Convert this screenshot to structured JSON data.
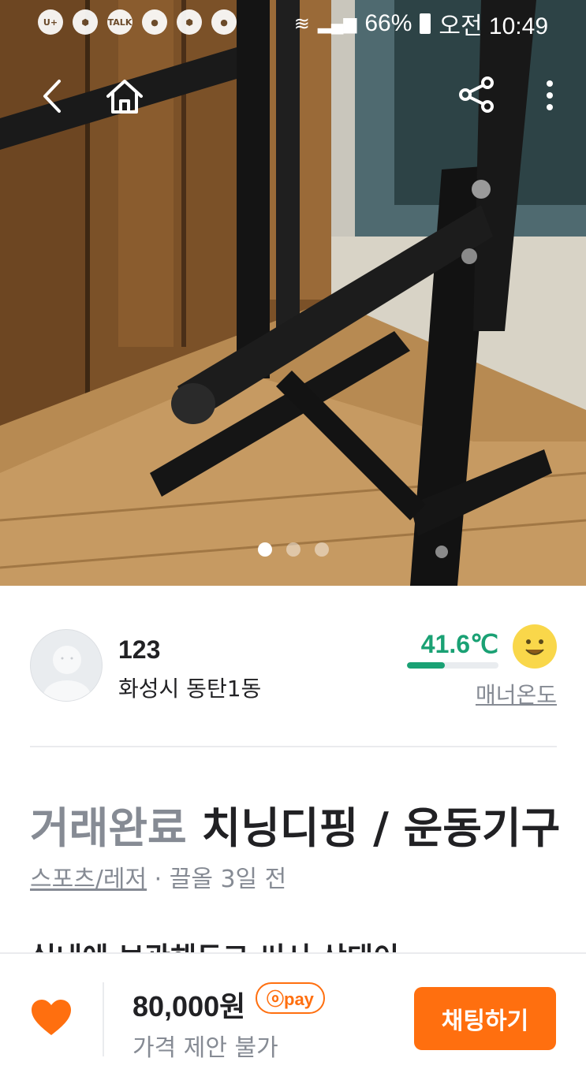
{
  "status_bar": {
    "left_icons": [
      "U+",
      "hive",
      "TALK",
      "app",
      "hive",
      "app"
    ],
    "battery": "66%",
    "time": "오전 10:49"
  },
  "nav": {
    "back_icon": "chevron-left-icon",
    "home_icon": "home-icon",
    "share_icon": "share-icon",
    "more_icon": "more-vertical-icon"
  },
  "gallery": {
    "count": 3,
    "active_index": 0
  },
  "seller": {
    "name": "123",
    "location": "화성시 동탄1동",
    "temperature": "41.6℃",
    "temperature_level": 0.416,
    "manner_label": "매너온도",
    "temperature_color": "#1aa174"
  },
  "product": {
    "status": "거래완료",
    "title": "치닝디핑 / 운동기구",
    "category": "스포츠/레저",
    "time_separator": " · ",
    "time": "끌올 3일 전",
    "description_preview": "실내에 보관해두고 써서 상태이"
  },
  "bottom_bar": {
    "like_icon": "heart-icon",
    "price": "80,000원",
    "pay_badge": "ⓞpay",
    "negotiation": "가격 제안 불가",
    "chat_button": "채팅하기",
    "accent_color": "#ff6f0f"
  }
}
